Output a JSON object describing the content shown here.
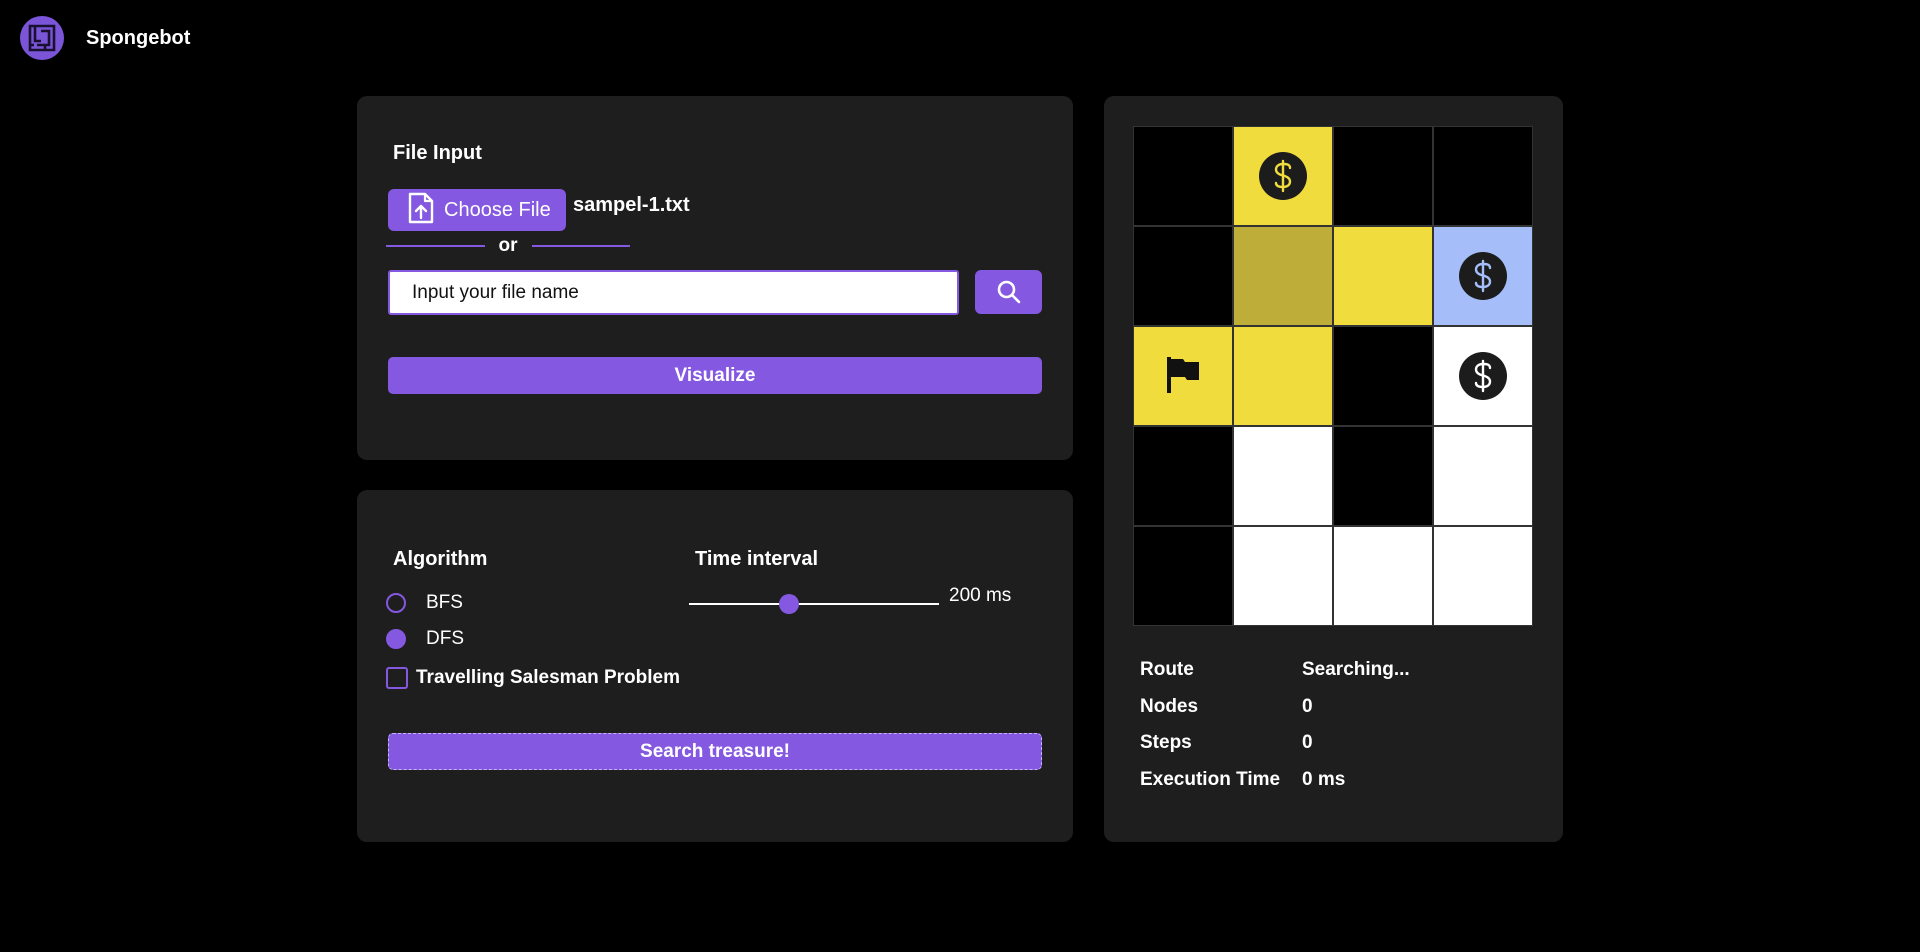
{
  "app": {
    "name": "Spongebot"
  },
  "file_panel": {
    "title": "File Input",
    "choose_label": "Choose File",
    "selected_file": "sampel-1.txt",
    "or_text": "or",
    "filename_placeholder": "Input your file name",
    "filename_value": "",
    "visualize_label": "Visualize"
  },
  "algo_panel": {
    "algorithm_title": "Algorithm",
    "options": [
      {
        "label": "BFS",
        "selected": false
      },
      {
        "label": "DFS",
        "selected": true
      }
    ],
    "time_title": "Time interval",
    "slider": {
      "min": 0,
      "max": 500,
      "value": 200
    },
    "time_value": "200 ms",
    "tsp_label": "Travelling Salesman Problem",
    "tsp_checked": false,
    "search_label": "Search treasure!"
  },
  "maze": {
    "rows": 5,
    "cols": 4,
    "colors": {
      "wall": "#000000",
      "path": "#ffffff",
      "visited": "#f0dc3c",
      "backtracked": "#bfad3a",
      "current": "#a5befa",
      "accent": "#8458e0"
    },
    "cells": [
      [
        "wall",
        "visited",
        "wall",
        "wall"
      ],
      [
        "wall",
        "backtracked",
        "visited",
        "current"
      ],
      [
        "visited",
        "visited",
        "wall",
        "path"
      ],
      [
        "wall",
        "path",
        "wall",
        "path"
      ],
      [
        "wall",
        "path",
        "path",
        "path"
      ]
    ],
    "icons": [
      {
        "row": 0,
        "col": 1,
        "icon": "treasure-icon",
        "glyph_color": "#f0dc3c"
      },
      {
        "row": 1,
        "col": 3,
        "icon": "treasure-icon",
        "glyph_color": "#a5befa"
      },
      {
        "row": 2,
        "col": 3,
        "icon": "treasure-icon",
        "glyph_color": "#ffffff"
      },
      {
        "row": 2,
        "col": 0,
        "icon": "start-flag-icon"
      }
    ]
  },
  "stats": [
    {
      "key": "Route",
      "value": "Searching..."
    },
    {
      "key": "Nodes",
      "value": "0"
    },
    {
      "key": "Steps",
      "value": "0"
    },
    {
      "key": "Execution Time",
      "value": "0 ms"
    }
  ]
}
